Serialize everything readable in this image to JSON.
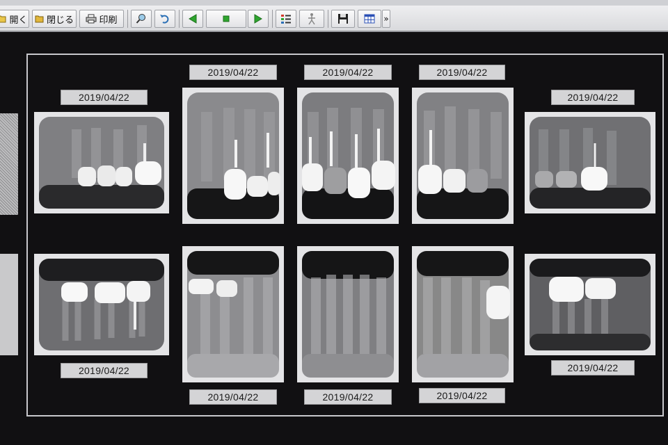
{
  "toolbar": {
    "open_label": "開く",
    "close_label": "閉じる",
    "print_label": "印刷",
    "overflow": "»"
  },
  "viewer": {
    "top_row_dates": [
      "2019/04/22",
      "2019/04/22",
      "2019/04/22",
      "2019/04/22",
      "2019/04/22"
    ],
    "bottom_row_dates": [
      "2019/04/22",
      "2019/04/22",
      "2019/04/22",
      "2019/04/22",
      "2019/04/22"
    ]
  },
  "colors": {
    "accent_green": "#2fa52f",
    "film_border": "#e4e4e6",
    "date_label_bg": "#d4d4d6"
  }
}
